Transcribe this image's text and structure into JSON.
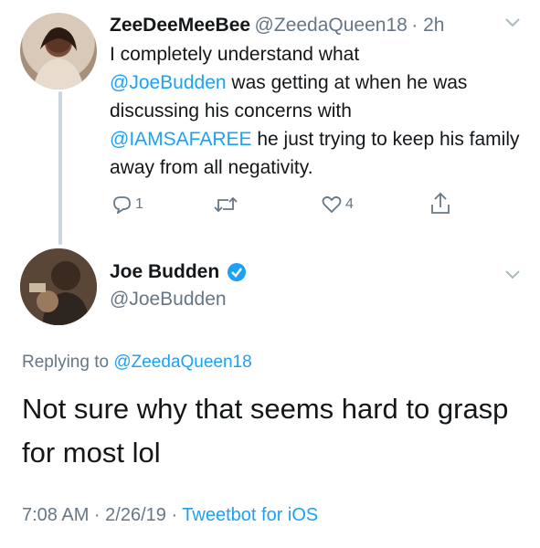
{
  "parent_tweet": {
    "display_name": "ZeeDeeMeeBee",
    "handle": "@ZeedaQueen18",
    "time": "· 2h",
    "text_1": "I completely understand what",
    "mention_1": "@JoeBudden",
    "text_2": " was getting at when he was discussing his concerns with",
    "mention_2": "@IAMSAFAREE",
    "text_3": " he just trying to keep his family away from all negativity.",
    "reply_count": "1",
    "retweet_count": "",
    "like_count": "4",
    "icons": {
      "reply": "reply-icon",
      "retweet": "retweet-icon",
      "like": "heart-icon",
      "share": "share-icon",
      "menu": "chevron-down-icon"
    }
  },
  "main_tweet": {
    "display_name": "Joe Budden",
    "handle": "@JoeBudden",
    "verified": true,
    "replying_prefix": "Replying to",
    "replying_to": "@ZeedaQueen18",
    "text": "Not sure why that seems hard to grasp for most lol",
    "timestamp": "7:08 AM · 2/26/19 · ",
    "client": "Tweetbot for iOS"
  },
  "colors": {
    "accent": "#1da1f2",
    "secondary_text": "#657786",
    "primary_text": "#14171a",
    "thread_line": "#ccd6dd"
  }
}
